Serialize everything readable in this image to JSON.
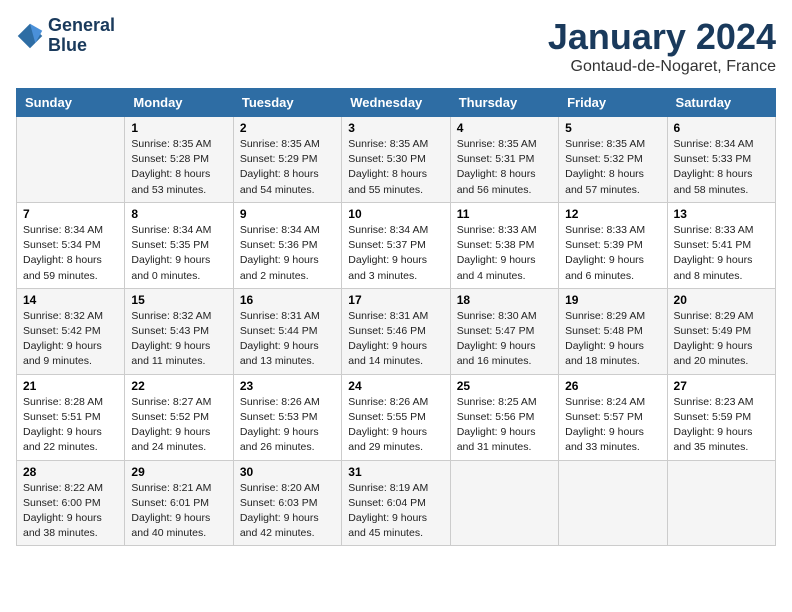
{
  "header": {
    "logo_line1": "General",
    "logo_line2": "Blue",
    "month": "January 2024",
    "location": "Gontaud-de-Nogaret, France"
  },
  "days_of_week": [
    "Sunday",
    "Monday",
    "Tuesday",
    "Wednesday",
    "Thursday",
    "Friday",
    "Saturday"
  ],
  "weeks": [
    [
      {
        "day": "",
        "sunrise": "",
        "sunset": "",
        "daylight": ""
      },
      {
        "day": "1",
        "sunrise": "Sunrise: 8:35 AM",
        "sunset": "Sunset: 5:28 PM",
        "daylight": "Daylight: 8 hours and 53 minutes."
      },
      {
        "day": "2",
        "sunrise": "Sunrise: 8:35 AM",
        "sunset": "Sunset: 5:29 PM",
        "daylight": "Daylight: 8 hours and 54 minutes."
      },
      {
        "day": "3",
        "sunrise": "Sunrise: 8:35 AM",
        "sunset": "Sunset: 5:30 PM",
        "daylight": "Daylight: 8 hours and 55 minutes."
      },
      {
        "day": "4",
        "sunrise": "Sunrise: 8:35 AM",
        "sunset": "Sunset: 5:31 PM",
        "daylight": "Daylight: 8 hours and 56 minutes."
      },
      {
        "day": "5",
        "sunrise": "Sunrise: 8:35 AM",
        "sunset": "Sunset: 5:32 PM",
        "daylight": "Daylight: 8 hours and 57 minutes."
      },
      {
        "day": "6",
        "sunrise": "Sunrise: 8:34 AM",
        "sunset": "Sunset: 5:33 PM",
        "daylight": "Daylight: 8 hours and 58 minutes."
      }
    ],
    [
      {
        "day": "7",
        "sunrise": "Sunrise: 8:34 AM",
        "sunset": "Sunset: 5:34 PM",
        "daylight": "Daylight: 8 hours and 59 minutes."
      },
      {
        "day": "8",
        "sunrise": "Sunrise: 8:34 AM",
        "sunset": "Sunset: 5:35 PM",
        "daylight": "Daylight: 9 hours and 0 minutes."
      },
      {
        "day": "9",
        "sunrise": "Sunrise: 8:34 AM",
        "sunset": "Sunset: 5:36 PM",
        "daylight": "Daylight: 9 hours and 2 minutes."
      },
      {
        "day": "10",
        "sunrise": "Sunrise: 8:34 AM",
        "sunset": "Sunset: 5:37 PM",
        "daylight": "Daylight: 9 hours and 3 minutes."
      },
      {
        "day": "11",
        "sunrise": "Sunrise: 8:33 AM",
        "sunset": "Sunset: 5:38 PM",
        "daylight": "Daylight: 9 hours and 4 minutes."
      },
      {
        "day": "12",
        "sunrise": "Sunrise: 8:33 AM",
        "sunset": "Sunset: 5:39 PM",
        "daylight": "Daylight: 9 hours and 6 minutes."
      },
      {
        "day": "13",
        "sunrise": "Sunrise: 8:33 AM",
        "sunset": "Sunset: 5:41 PM",
        "daylight": "Daylight: 9 hours and 8 minutes."
      }
    ],
    [
      {
        "day": "14",
        "sunrise": "Sunrise: 8:32 AM",
        "sunset": "Sunset: 5:42 PM",
        "daylight": "Daylight: 9 hours and 9 minutes."
      },
      {
        "day": "15",
        "sunrise": "Sunrise: 8:32 AM",
        "sunset": "Sunset: 5:43 PM",
        "daylight": "Daylight: 9 hours and 11 minutes."
      },
      {
        "day": "16",
        "sunrise": "Sunrise: 8:31 AM",
        "sunset": "Sunset: 5:44 PM",
        "daylight": "Daylight: 9 hours and 13 minutes."
      },
      {
        "day": "17",
        "sunrise": "Sunrise: 8:31 AM",
        "sunset": "Sunset: 5:46 PM",
        "daylight": "Daylight: 9 hours and 14 minutes."
      },
      {
        "day": "18",
        "sunrise": "Sunrise: 8:30 AM",
        "sunset": "Sunset: 5:47 PM",
        "daylight": "Daylight: 9 hours and 16 minutes."
      },
      {
        "day": "19",
        "sunrise": "Sunrise: 8:29 AM",
        "sunset": "Sunset: 5:48 PM",
        "daylight": "Daylight: 9 hours and 18 minutes."
      },
      {
        "day": "20",
        "sunrise": "Sunrise: 8:29 AM",
        "sunset": "Sunset: 5:49 PM",
        "daylight": "Daylight: 9 hours and 20 minutes."
      }
    ],
    [
      {
        "day": "21",
        "sunrise": "Sunrise: 8:28 AM",
        "sunset": "Sunset: 5:51 PM",
        "daylight": "Daylight: 9 hours and 22 minutes."
      },
      {
        "day": "22",
        "sunrise": "Sunrise: 8:27 AM",
        "sunset": "Sunset: 5:52 PM",
        "daylight": "Daylight: 9 hours and 24 minutes."
      },
      {
        "day": "23",
        "sunrise": "Sunrise: 8:26 AM",
        "sunset": "Sunset: 5:53 PM",
        "daylight": "Daylight: 9 hours and 26 minutes."
      },
      {
        "day": "24",
        "sunrise": "Sunrise: 8:26 AM",
        "sunset": "Sunset: 5:55 PM",
        "daylight": "Daylight: 9 hours and 29 minutes."
      },
      {
        "day": "25",
        "sunrise": "Sunrise: 8:25 AM",
        "sunset": "Sunset: 5:56 PM",
        "daylight": "Daylight: 9 hours and 31 minutes."
      },
      {
        "day": "26",
        "sunrise": "Sunrise: 8:24 AM",
        "sunset": "Sunset: 5:57 PM",
        "daylight": "Daylight: 9 hours and 33 minutes."
      },
      {
        "day": "27",
        "sunrise": "Sunrise: 8:23 AM",
        "sunset": "Sunset: 5:59 PM",
        "daylight": "Daylight: 9 hours and 35 minutes."
      }
    ],
    [
      {
        "day": "28",
        "sunrise": "Sunrise: 8:22 AM",
        "sunset": "Sunset: 6:00 PM",
        "daylight": "Daylight: 9 hours and 38 minutes."
      },
      {
        "day": "29",
        "sunrise": "Sunrise: 8:21 AM",
        "sunset": "Sunset: 6:01 PM",
        "daylight": "Daylight: 9 hours and 40 minutes."
      },
      {
        "day": "30",
        "sunrise": "Sunrise: 8:20 AM",
        "sunset": "Sunset: 6:03 PM",
        "daylight": "Daylight: 9 hours and 42 minutes."
      },
      {
        "day": "31",
        "sunrise": "Sunrise: 8:19 AM",
        "sunset": "Sunset: 6:04 PM",
        "daylight": "Daylight: 9 hours and 45 minutes."
      },
      {
        "day": "",
        "sunrise": "",
        "sunset": "",
        "daylight": ""
      },
      {
        "day": "",
        "sunrise": "",
        "sunset": "",
        "daylight": ""
      },
      {
        "day": "",
        "sunrise": "",
        "sunset": "",
        "daylight": ""
      }
    ]
  ]
}
